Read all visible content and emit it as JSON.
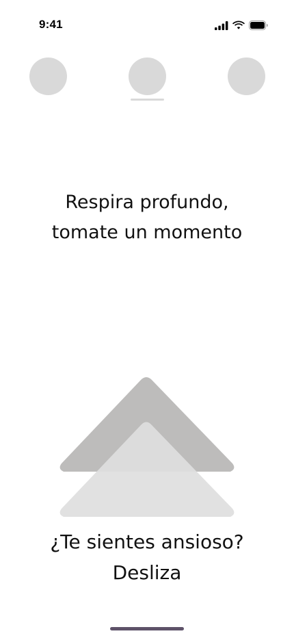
{
  "status_bar": {
    "time": "9:41",
    "signal_icon": "cellular-signal-icon",
    "wifi_icon": "wifi-icon",
    "battery_icon": "battery-icon"
  },
  "carousel": {
    "items": [
      {
        "name": "option-left"
      },
      {
        "name": "option-center",
        "selected": true
      },
      {
        "name": "option-right"
      }
    ]
  },
  "prompt": {
    "line1": "Respira profundo,",
    "line2": "tomate un momento"
  },
  "swipe": {
    "icon": "swipe-up-chevron-icon",
    "back_color": "#bdbcbb",
    "front_color": "#dedede"
  },
  "cta": {
    "line1": "¿Te sientes ansioso?",
    "line2": "Desliza"
  },
  "colors": {
    "placeholder": "#d9d9d9",
    "home_indicator": "#5e5269",
    "text": "#111111"
  }
}
